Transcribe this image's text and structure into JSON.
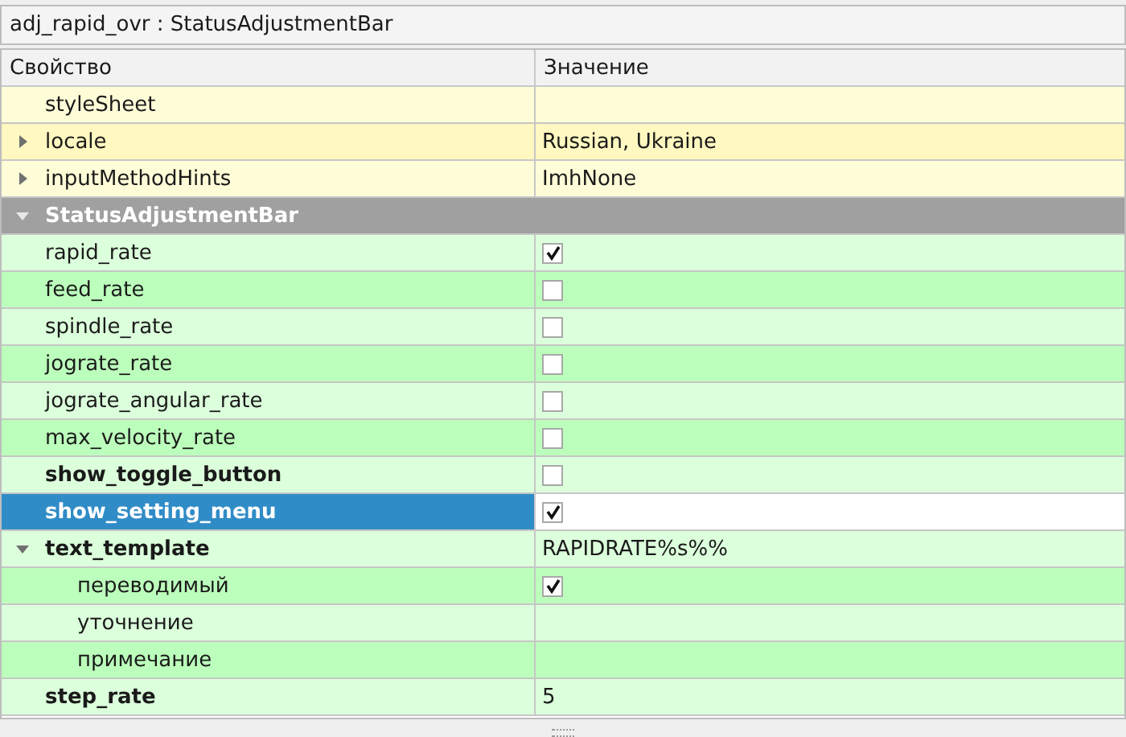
{
  "title": "adj_rapid_ovr : StatusAdjustmentBar",
  "columns": [
    "Свойство",
    "Значение"
  ],
  "rows": [
    {
      "kind": "property",
      "name": "styleSheet",
      "bold": false,
      "color": "#fffdd8",
      "selected": false
    },
    {
      "kind": "property",
      "name": "locale",
      "bold": false,
      "color": "#fff8c0",
      "selected": false,
      "expanded": false,
      "value": "Russian, Ukraine"
    },
    {
      "kind": "property",
      "name": "inputMethodHints",
      "bold": false,
      "color": "#fffdd8",
      "selected": false,
      "expanded": false,
      "value": "ImhNone"
    },
    {
      "kind": "section",
      "name": "StatusAdjustmentBar",
      "expanded": true,
      "selected": false,
      "children": [
        {
          "kind": "property",
          "name": "rapid_rate",
          "bold": false,
          "color": "#dcffdc",
          "selected": false,
          "checked": true
        },
        {
          "kind": "property",
          "name": "feed_rate",
          "bold": false,
          "color": "#bcffbc",
          "selected": false,
          "checked": false
        },
        {
          "kind": "property",
          "name": "spindle_rate",
          "bold": false,
          "color": "#dcffdc",
          "selected": false,
          "checked": false
        },
        {
          "kind": "property",
          "name": "jograte_rate",
          "bold": false,
          "color": "#bcffbc",
          "selected": false,
          "checked": false
        },
        {
          "kind": "property",
          "name": "jograte_angular_rate",
          "bold": false,
          "color": "#dcffdc",
          "selected": false,
          "checked": false
        },
        {
          "kind": "property",
          "name": "max_velocity_rate",
          "bold": false,
          "color": "#bcffbc",
          "selected": false,
          "checked": false
        },
        {
          "kind": "property",
          "name": "show_toggle_button",
          "bold": true,
          "color": "#dcffdc",
          "selected": false,
          "checked": false
        },
        {
          "kind": "property",
          "name": "show_setting_menu",
          "bold": true,
          "selected": true,
          "checked": true
        },
        {
          "kind": "property",
          "name": "text_template",
          "bold": true,
          "color": "#dcffdc",
          "selected": false,
          "expanded": true,
          "value": "RAPIDRATE%s%%",
          "children": [
            {
              "kind": "property",
              "name": "переводимый",
              "bold": false,
              "color": "#bcffbc",
              "selected": false,
              "checked": true
            },
            {
              "kind": "property",
              "name": "уточнение",
              "bold": false,
              "color": "#dcffdc",
              "selected": false
            },
            {
              "kind": "property",
              "name": "примечание",
              "bold": false,
              "color": "#bcffbc",
              "selected": false
            }
          ]
        },
        {
          "kind": "property",
          "name": "step_rate",
          "bold": true,
          "color": "#dcffdc",
          "selected": false,
          "value": "5"
        }
      ]
    }
  ]
}
